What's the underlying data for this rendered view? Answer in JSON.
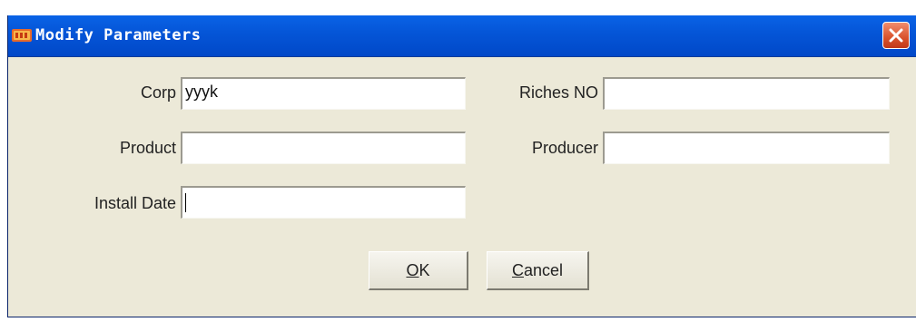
{
  "dialog": {
    "title": "Modify Parameters",
    "app_logo": "itop"
  },
  "fields": {
    "corp": {
      "label": "Corp",
      "value": "yyyk"
    },
    "riches_no": {
      "label": "Riches NO",
      "value": ""
    },
    "product": {
      "label": "Product",
      "value": ""
    },
    "producer": {
      "label": "Producer",
      "value": ""
    },
    "install_date": {
      "label": "Install Date",
      "value": ""
    }
  },
  "buttons": {
    "ok": {
      "mnemonic": "O",
      "rest": "K"
    },
    "cancel": {
      "mnemonic": "C",
      "rest": "ancel"
    }
  },
  "colors": {
    "titlebar": "#0556D8",
    "dialog_bg": "#ECE9D8",
    "close_button": "#D9522C"
  },
  "icons": {
    "close": "close-icon"
  }
}
